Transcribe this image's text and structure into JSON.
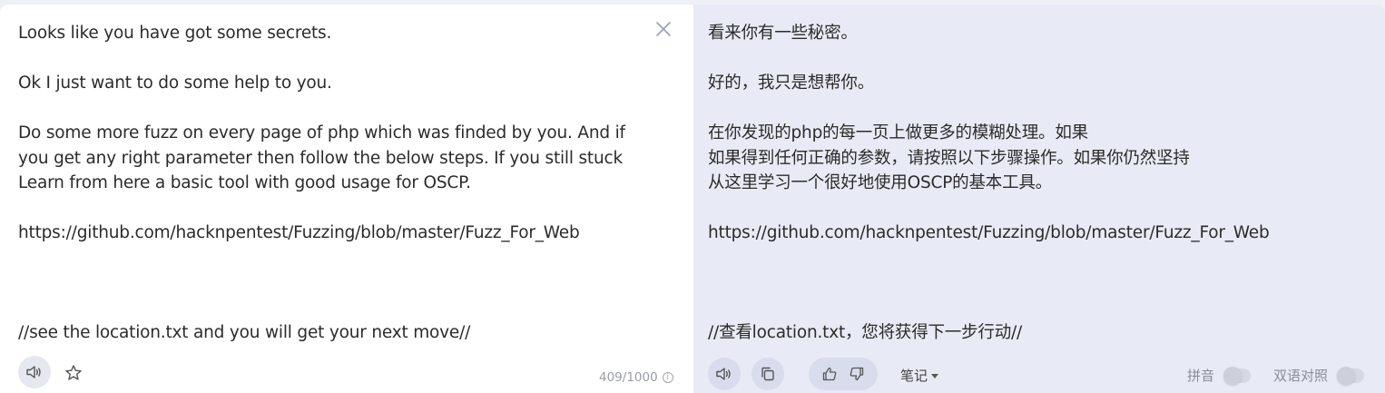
{
  "source": {
    "text": "Looks like you have got some secrets.\n\nOk I just want to do some help to you.\n\nDo some more fuzz on every page of php which was finded by you. And if\nyou get any right parameter then follow the below steps. If you still stuck\nLearn from here a basic tool with good usage for OSCP.\n\nhttps://github.com/hacknpentest/Fuzzing/blob/master/Fuzz_For_Web\n\n\n\n//see the location.txt and you will get your next move//",
    "char_count": "409/1000",
    "info_glyph": "i"
  },
  "translation": {
    "text": "看来你有一些秘密。\n\n好的，我只是想帮你。\n\n在你发现的php的每一页上做更多的模糊处理。如果\n如果得到任何正确的参数，请按照以下步骤操作。如果你仍然坚持\n从这里学习一个很好地使用OSCP的基本工具。\n\nhttps://github.com/hacknpentest/Fuzzing/blob/master/Fuzz_For_Web\n\n\n\n//查看location.txt，您将获得下一步行动//",
    "notes_label": "笔记",
    "pinyin_label": "拼音",
    "bilingual_label": "双语对照"
  },
  "icons": {
    "close": "close-icon",
    "speaker": "speaker-icon",
    "star": "star-icon",
    "copy": "copy-icon",
    "thumbs_up": "thumbs-up-icon",
    "thumbs_down": "thumbs-down-icon",
    "info": "info-icon"
  },
  "colors": {
    "left_bg": "#ffffff",
    "right_bg": "#e8ebf5",
    "text": "#2b2b2b",
    "muted": "#9a9ca6"
  }
}
